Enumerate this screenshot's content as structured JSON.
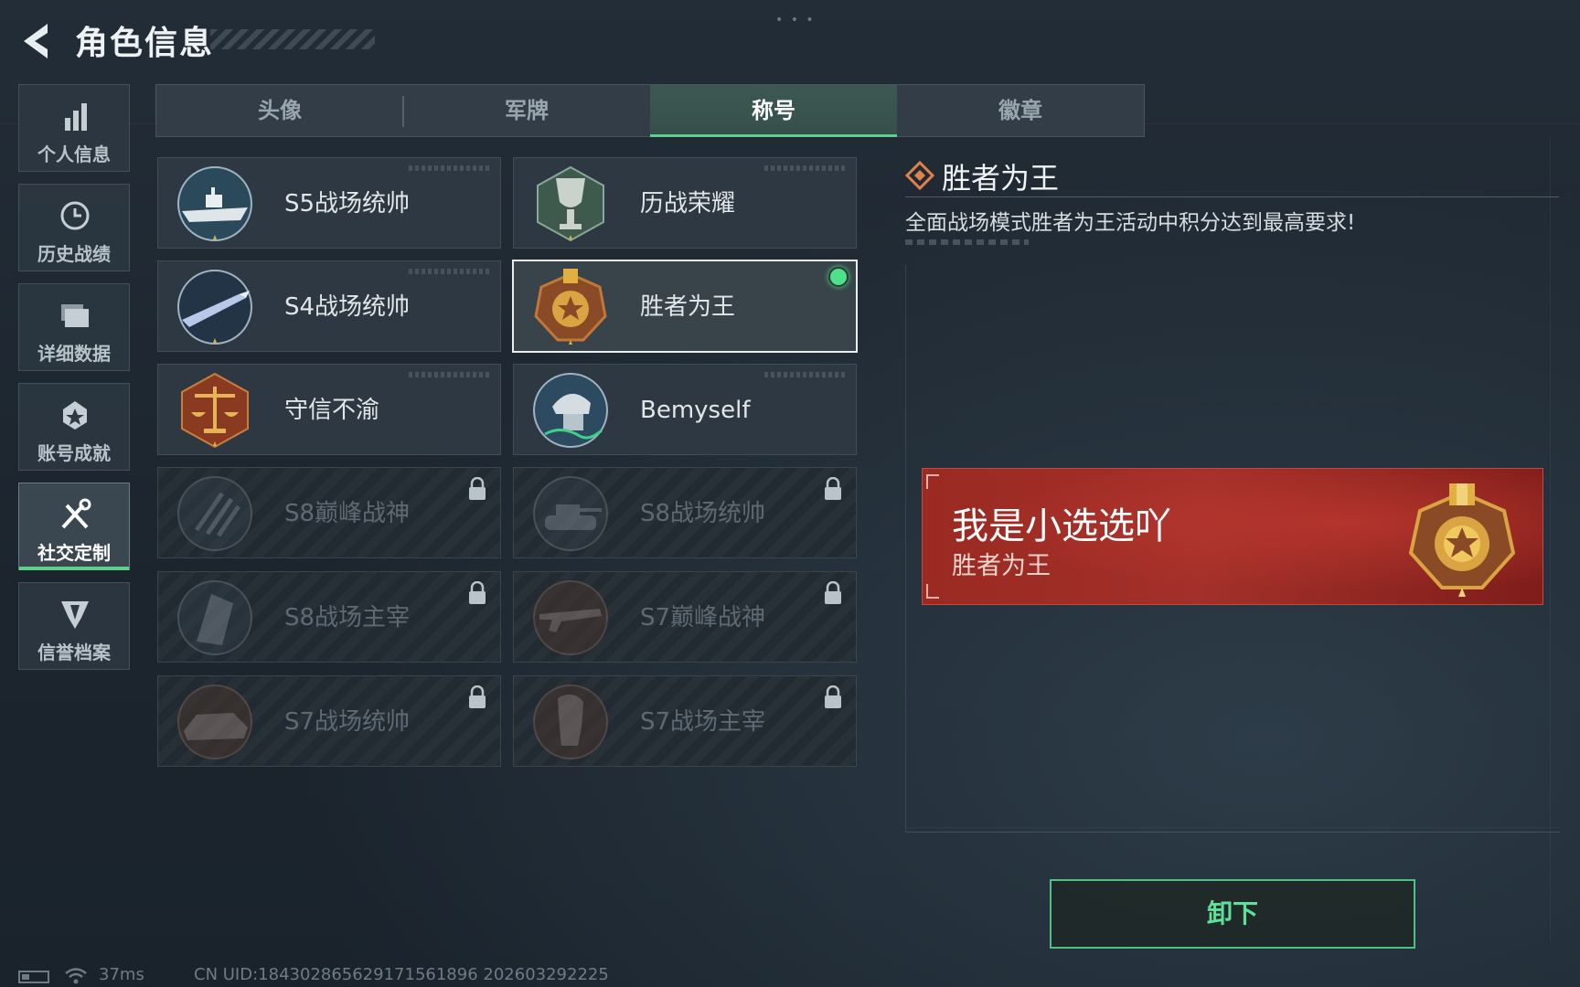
{
  "header": {
    "title": "角色信息"
  },
  "sidebar": {
    "items": [
      {
        "label": "个人信息",
        "icon": "bar-chart-icon"
      },
      {
        "label": "历史战绩",
        "icon": "history-clock-icon"
      },
      {
        "label": "详细数据",
        "icon": "folder-icon"
      },
      {
        "label": "账号成就",
        "icon": "achievement-star-icon"
      },
      {
        "label": "社交定制",
        "icon": "tools-icon",
        "active": true
      },
      {
        "label": "信誉档案",
        "icon": "shield-badge-icon"
      }
    ]
  },
  "tabs": [
    {
      "label": "头像"
    },
    {
      "label": "军牌"
    },
    {
      "label": "称号",
      "active": true
    },
    {
      "label": "徽章"
    }
  ],
  "titles": [
    {
      "name": "S5战场统帅",
      "emblem": "warship-emblem",
      "locked": false
    },
    {
      "name": "历战荣耀",
      "emblem": "trophy-emblem",
      "locked": false
    },
    {
      "name": "S4战场统帅",
      "emblem": "missile-emblem",
      "locked": false
    },
    {
      "name": "胜者为王",
      "emblem": "gold-medal-emblem",
      "locked": false,
      "selected": true,
      "equipped": true
    },
    {
      "name": "守信不渝",
      "emblem": "scales-emblem",
      "locked": false
    },
    {
      "name": "Bemyself",
      "emblem": "soldier-helmet-emblem",
      "locked": false
    },
    {
      "name": "S8巅峰战神",
      "emblem": "claw-emblem",
      "locked": true
    },
    {
      "name": "S8战场统帅",
      "emblem": "tank-emblem",
      "locked": true
    },
    {
      "name": "S8战场主宰",
      "emblem": "building-emblem",
      "locked": true
    },
    {
      "name": "S7巅峰战神",
      "emblem": "rifle-emblem",
      "locked": true
    },
    {
      "name": "S7战场统帅",
      "emblem": "vehicle-emblem",
      "locked": true
    },
    {
      "name": "S7战场主宰",
      "emblem": "warrior-emblem",
      "locked": true
    }
  ],
  "detail": {
    "title": "胜者为王",
    "description": "全面战场模式胜者为王活动中积分达到最高要求!"
  },
  "banner": {
    "player_name": "我是小选选吖",
    "title": "胜者为王"
  },
  "unequip_button": {
    "label": "卸下"
  },
  "status": {
    "latency": "37ms",
    "uid": "CN UID:1843028656291715618​96 202603292225"
  },
  "colors": {
    "accent_green": "#5fd08c",
    "banner_red": "#9a2a22",
    "gold": "#d9a441"
  }
}
